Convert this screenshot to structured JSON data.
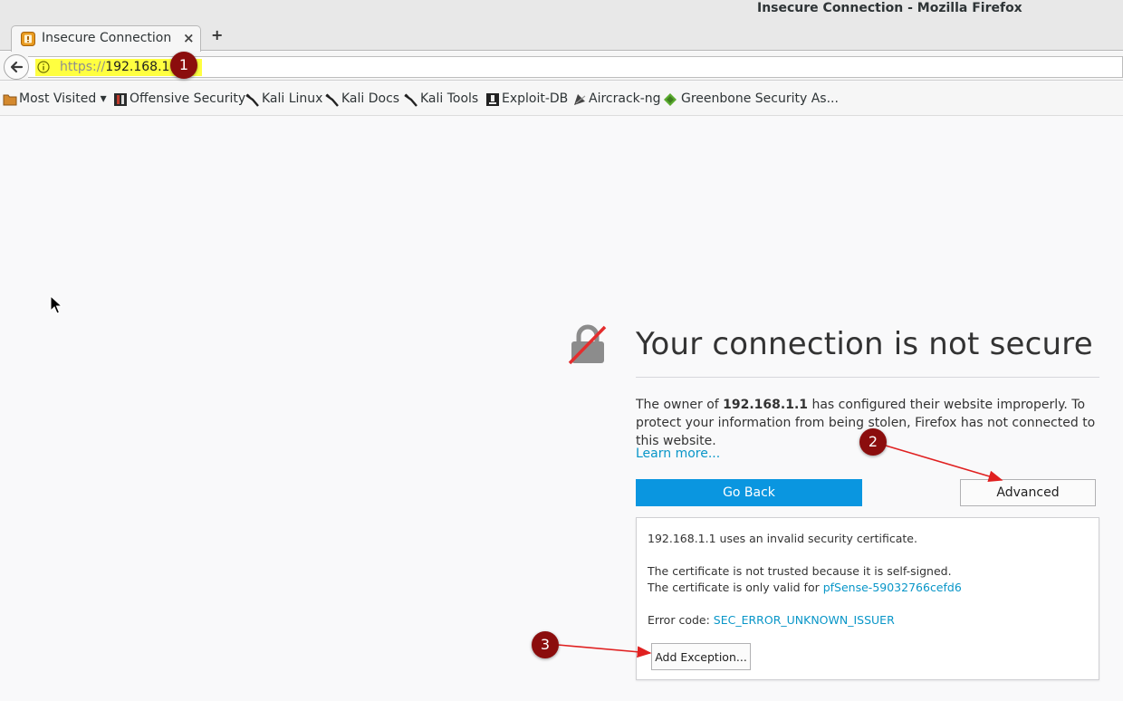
{
  "window": {
    "title": "Insecure Connection - Mozilla Firefox"
  },
  "tab": {
    "title": "Insecure Connection",
    "close_glyph": "×",
    "new_tab_glyph": "+"
  },
  "navbar": {
    "url_scheme": "https://",
    "url_host": "192.168.1.1"
  },
  "bookmarks": [
    {
      "label": "Most Visited ▾",
      "icon": "folder-icon"
    },
    {
      "label": "Offensive Security",
      "icon": "offsec-icon"
    },
    {
      "label": "Kali Linux",
      "icon": "kali-dragon-icon"
    },
    {
      "label": "Kali Docs",
      "icon": "kali-dragon-icon"
    },
    {
      "label": "Kali Tools",
      "icon": "kali-dragon-icon"
    },
    {
      "label": "Exploit-DB",
      "icon": "exploitdb-icon"
    },
    {
      "label": "Aircrack-ng",
      "icon": "aircrack-icon"
    },
    {
      "label": "Greenbone Security As...",
      "icon": "greenbone-icon"
    }
  ],
  "error_page": {
    "heading": "Your connection is not secure",
    "desc_pre": "The owner of ",
    "desc_host": "192.168.1.1",
    "desc_post": " has configured their website improperly. To protect your information from being stolen, Firefox has not connected to this website.",
    "learn_more": "Learn more...",
    "go_back": "Go Back",
    "advanced": "Advanced",
    "advanced_panel": {
      "line1": "192.168.1.1 uses an invalid security certificate.",
      "line2": "The certificate is not trusted because it is self-signed.",
      "line3_pre": "The certificate is only valid for ",
      "line3_link": "pfSense-59032766cefd6",
      "line4_pre": "Error code: ",
      "line4_link": "SEC_ERROR_UNKNOWN_ISSUER",
      "add_exception": "Add Exception..."
    }
  },
  "annotations": [
    {
      "label": "1"
    },
    {
      "label": "2"
    },
    {
      "label": "3"
    }
  ],
  "colors": {
    "accent_blue": "#0a96e0",
    "link": "#0996c8",
    "marker_red": "#8b0d0d",
    "url_highlight": "#ffff40"
  }
}
